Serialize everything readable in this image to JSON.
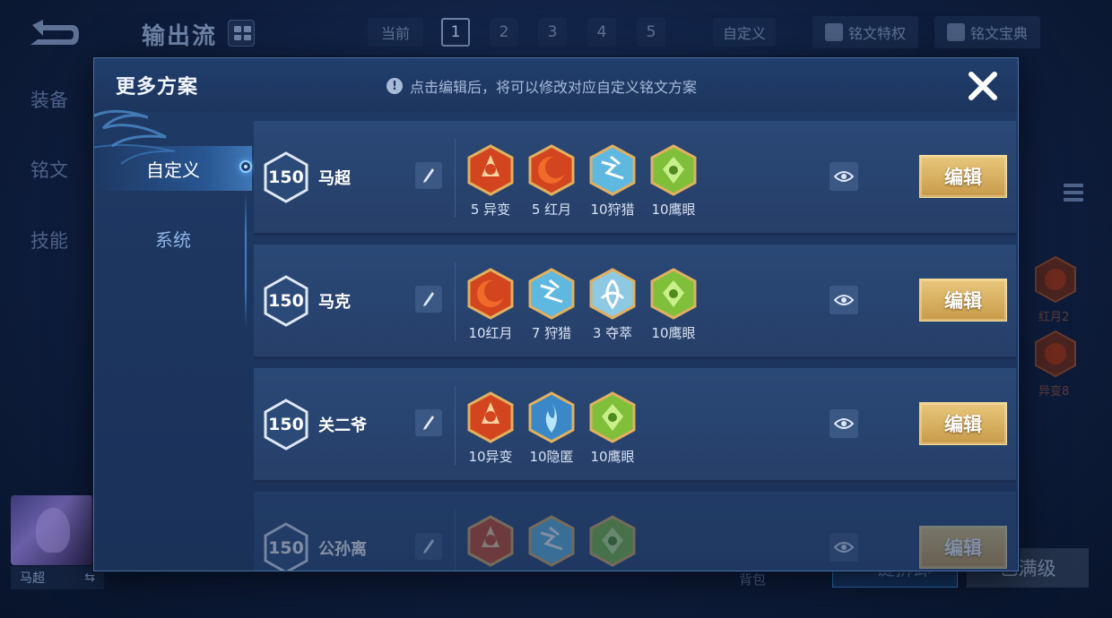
{
  "background": {
    "top_title": "输出流",
    "current_label": "当前",
    "page_numbers": [
      "1",
      "2",
      "3",
      "4",
      "5"
    ],
    "active_page": "1",
    "custom_label": "自定义",
    "privilege_label": "铭文特权",
    "codex_label": "铭文宝典",
    "side_tabs": [
      "装备",
      "铭文",
      "技能"
    ],
    "hero_name": "马超",
    "hero_swap_glyph": "⇆",
    "bag_label": "背包",
    "btn_left": "一键拆卸",
    "btn_right": "已满级",
    "right_runes": [
      "红月2",
      "异变8"
    ]
  },
  "modal": {
    "title": "更多方案",
    "hint": "点击编辑后，将可以修改对应自定义铭文方案",
    "hint_icon_glyph": "!",
    "close_glyph": "✕",
    "nav": [
      {
        "label": "自定义",
        "active": true
      },
      {
        "label": "系统",
        "active": false
      }
    ],
    "edit_label": "编辑",
    "plans": [
      {
        "level": "150",
        "name": "马超",
        "runes": [
          {
            "type": "yibian",
            "label": "5 异变"
          },
          {
            "type": "hongyue",
            "label": "5 红月"
          },
          {
            "type": "shoulie",
            "label": "10狩猎"
          },
          {
            "type": "yingyan",
            "label": "10鹰眼"
          }
        ]
      },
      {
        "level": "150",
        "name": "马克",
        "runes": [
          {
            "type": "hongyue",
            "label": "10红月"
          },
          {
            "type": "shoulie",
            "label": "7 狩猎"
          },
          {
            "type": "duocui",
            "label": "3 夺萃"
          },
          {
            "type": "yingyan",
            "label": "10鹰眼"
          }
        ]
      },
      {
        "level": "150",
        "name": "关二爷",
        "runes": [
          {
            "type": "yibian",
            "label": "10异变"
          },
          {
            "type": "yinni",
            "label": "10隐匿"
          },
          {
            "type": "yingyan",
            "label": "10鹰眼"
          }
        ]
      },
      {
        "level": "150",
        "name": "公孙离",
        "runes": [
          {
            "type": "yibian",
            "label": ""
          },
          {
            "type": "shoulie",
            "label": ""
          },
          {
            "type": "yingyan",
            "label": ""
          }
        ]
      }
    ]
  },
  "colors": {
    "edit_gold": "#e8c77c",
    "rune_red": "#d2451f",
    "rune_blue": "#5fb8e0",
    "rune_green": "#7fbf3a",
    "rune_gold_rim": "#e0b060"
  }
}
